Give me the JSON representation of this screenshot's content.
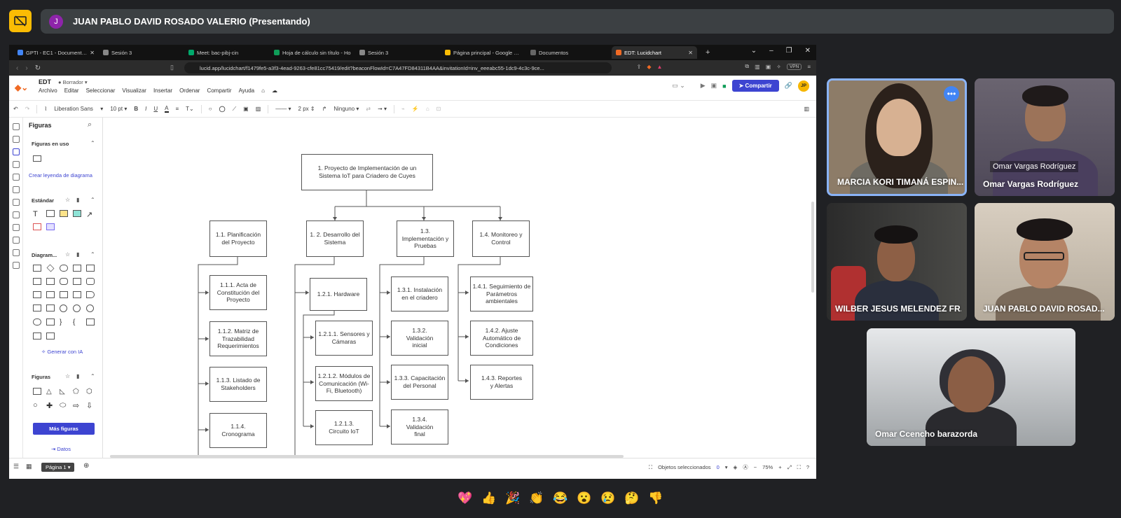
{
  "meet": {
    "presenter_initial": "J",
    "presenter_label": "JUAN PABLO DAVID ROSADO VALERIO (Presentando)"
  },
  "browser": {
    "tabs": [
      {
        "title": "GPTI - EC1 - Documentos",
        "color": "#4285f4"
      },
      {
        "title": "Sesión 3",
        "color": "#888888"
      },
      {
        "title": "Meet: bac-pibj-cin",
        "color": "#00a86b"
      },
      {
        "title": "Hoja de cálculo sin título - Ho",
        "color": "#0f9d58"
      },
      {
        "title": "Sesión 3",
        "color": "#888888"
      },
      {
        "title": "Página principal - Google Driv",
        "color": "#fbbc04"
      },
      {
        "title": "Documentos",
        "color": "#666666"
      },
      {
        "title": "EDT: Lucidchart",
        "color": "#f06a24"
      }
    ],
    "url": "lucid.app/lucidchart/f1479fe5-a3f3-4ead-9263-cfe81cc75419/edit?beaconFlowId=C7A47FD84311B4AA&invitationId=inv_eeeabc55-1dc9-4c3c-9ce...",
    "vpn": "VPN"
  },
  "lucid": {
    "doc_title": "EDT",
    "status": "Borrador",
    "menus": [
      "Archivo",
      "Editar",
      "Seleccionar",
      "Visualizar",
      "Insertar",
      "Ordenar",
      "Compartir",
      "Ayuda"
    ],
    "share": "Compartir",
    "user_initials": "JP",
    "font": "Liberation Sans",
    "font_size": "10 pt",
    "line_width": "2 px",
    "arrow_start": "Ninguno"
  },
  "panel": {
    "title": "Figuras",
    "in_use": "Figuras en uso",
    "legend_link": "Crear leyenda de diagrama",
    "standard": "Estándar",
    "diagram": "Diagram...",
    "ai_link": "Generar con IA",
    "figures": "Figuras",
    "more": "Más figuras",
    "data": "Datos"
  },
  "diagram": {
    "root": "1. Proyecto de Implementación de un Sistema IoT para Criadero de Cuyes",
    "l1": [
      "1.1. Planificación del Proyecto",
      "1. 2. Desarrollo del Sistema",
      "1.3. Implementación y Pruebas",
      "1.4. Monitoreo y Control"
    ],
    "b1": [
      "1.1.1. Acta de Constitución del Proyecto",
      "1.1.2. Matriz de Trazabilidad Requerimientos",
      "1.1.3. Listado de Stakeholders",
      "1.1.4. Cronograma"
    ],
    "b2": [
      "1.2.1. Hardware",
      "1.2.1.1. Sensores y Cámaras",
      "1.2.1.2. Módulos de Comunicación (Wi-Fi, Bluetooth)",
      "1.2.1.3. Circuito IoT"
    ],
    "b3": [
      "1.3.1. Instalación en el criadero",
      "1.3.2. Validación inicial",
      "1.3.3. Capacitación del Personal",
      "1.3.4. Validación final"
    ],
    "b4": [
      "1.4.1. Seguimiento de Parámetros ambientales",
      "1.4.2. Ajuste Automático de Condiciones",
      "1.4.3. Reportes y Alertas"
    ]
  },
  "bottom": {
    "page": "Página 1",
    "selected": "Objetos seleccionados",
    "selected_count": "0",
    "zoom": "75%"
  },
  "participants": [
    {
      "name": "MARCIA KORI TIMANÁ ESPIN..."
    },
    {
      "name": "Omar Vargas Rodríguez",
      "overlay": "Omar Vargas Rodríguez"
    },
    {
      "name": "WILBER JESUS MELENDEZ FR..."
    },
    {
      "name": "JUAN PABLO DAVID ROSAD..."
    },
    {
      "name": "Omar Ccencho barazorda"
    }
  ],
  "reactions": [
    "💖",
    "👍",
    "🎉",
    "👏",
    "😂",
    "😮",
    "😢",
    "🤔",
    "👎"
  ],
  "colors": {
    "accent": "#3d44d1",
    "meet_bg": "#202124",
    "lucid_orange": "#f06a24",
    "active_speaker": "#8ab4f8"
  }
}
